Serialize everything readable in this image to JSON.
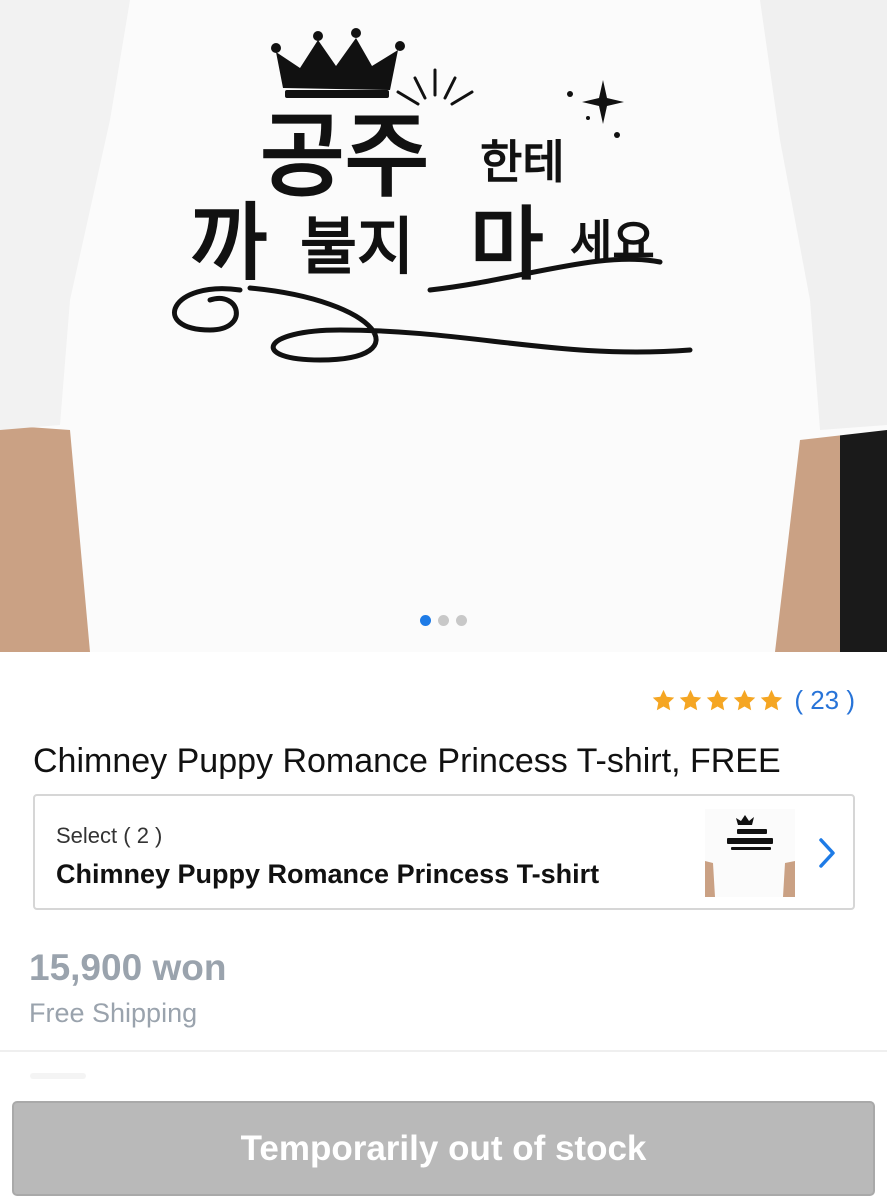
{
  "product_image": {
    "alt": "Printed T-shirt",
    "slide_count": 3,
    "active_slide": 1,
    "print_text": "공주한테 까불지 마세요"
  },
  "rating": {
    "stars": 5,
    "count_text": "( 23 )"
  },
  "product": {
    "title": "Chimney Puppy Romance Princess T-shirt, FREE"
  },
  "option": {
    "select_label": "Select ( 2 )",
    "name": "Chimney Puppy Romance Princess T-shirt",
    "chevron_icon": "chevron-right-icon"
  },
  "pricing": {
    "price": "15,900 won",
    "shipping": "Free Shipping"
  },
  "action": {
    "button_label": "Temporarily out of stock"
  },
  "colors": {
    "accent": "#1e7be6",
    "star": "#f5a623",
    "disabled_button": "#b9b9b9",
    "muted_text": "#9aa3ad"
  }
}
